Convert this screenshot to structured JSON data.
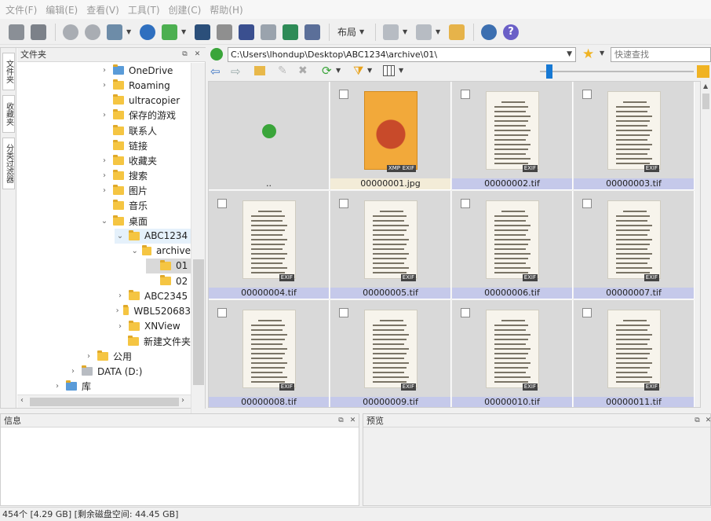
{
  "menu": [
    "文件(F)",
    "编辑(E)",
    "查看(V)",
    "工具(T)",
    "创建(C)",
    "帮助(H)"
  ],
  "toolbar": {
    "layout_label": "布局"
  },
  "side_tabs": [
    "文件夹",
    "收藏夹",
    "分类过滤器"
  ],
  "folder_panel_title": "文件夹",
  "tree": [
    {
      "label": "OneDrive",
      "indent": 1,
      "chevron": "›",
      "icon": "cloud-icon"
    },
    {
      "label": "Roaming",
      "indent": 1,
      "chevron": "›",
      "icon": "folder-icon"
    },
    {
      "label": "ultracopier",
      "indent": 1,
      "chevron": "",
      "icon": "folder-icon"
    },
    {
      "label": "保存的游戏",
      "indent": 1,
      "chevron": "›",
      "icon": "saved-games-icon"
    },
    {
      "label": "联系人",
      "indent": 1,
      "chevron": "",
      "icon": "contacts-icon"
    },
    {
      "label": "链接",
      "indent": 1,
      "chevron": "",
      "icon": "links-icon"
    },
    {
      "label": "收藏夹",
      "indent": 1,
      "chevron": "›",
      "icon": "favorites-icon"
    },
    {
      "label": "搜索",
      "indent": 1,
      "chevron": "›",
      "icon": "search-folder-icon"
    },
    {
      "label": "图片",
      "indent": 1,
      "chevron": "›",
      "icon": "pictures-icon"
    },
    {
      "label": "音乐",
      "indent": 1,
      "chevron": "",
      "icon": "music-icon"
    },
    {
      "label": "桌面",
      "indent": 1,
      "chevron": "⌄",
      "icon": "desktop-icon"
    },
    {
      "label": "ABC1234",
      "indent": 2,
      "chevron": "⌄",
      "icon": "folder-icon",
      "state": "selected"
    },
    {
      "label": "archive",
      "indent": 3,
      "chevron": "⌄",
      "icon": "folder-icon"
    },
    {
      "label": "01",
      "indent": 4,
      "chevron": "",
      "icon": "folder-open-icon",
      "state": "current"
    },
    {
      "label": "02",
      "indent": 4,
      "chevron": "",
      "icon": "folder-icon"
    },
    {
      "label": "ABC2345",
      "indent": 2,
      "chevron": "›",
      "icon": "folder-icon"
    },
    {
      "label": "WBL520683",
      "indent": 2,
      "chevron": "›",
      "icon": "folder-icon"
    },
    {
      "label": "XNView",
      "indent": 2,
      "chevron": "›",
      "icon": "folder-icon"
    },
    {
      "label": "新建文件夹",
      "indent": 2,
      "chevron": "",
      "icon": "folder-icon"
    },
    {
      "label": "公用",
      "indent": 0,
      "chevron": "›",
      "icon": "folder-icon"
    },
    {
      "label": "DATA (D:)",
      "indent": -1,
      "chevron": "›",
      "icon": "drive-icon"
    },
    {
      "label": "库",
      "indent": -2,
      "chevron": "›",
      "icon": "library-icon"
    }
  ],
  "address": "C:\\Users\\lhondup\\Desktop\\ABC1234\\archive\\01\\",
  "search_placeholder": "快速查找",
  "grid": [
    {
      "caption": "..",
      "kind": "up",
      "badges": []
    },
    {
      "caption": "00000001.jpg",
      "kind": "cover",
      "badges": [
        "XMP",
        "EXIF"
      ]
    },
    {
      "caption": "00000002.tif",
      "kind": "page",
      "badges": [
        "EXIF"
      ]
    },
    {
      "caption": "00000003.tif",
      "kind": "page",
      "badges": [
        "EXIF"
      ]
    },
    {
      "caption": "00000004.tif",
      "kind": "page",
      "badges": [
        "EXIF"
      ]
    },
    {
      "caption": "00000005.tif",
      "kind": "page",
      "badges": [
        "EXIF"
      ]
    },
    {
      "caption": "00000006.tif",
      "kind": "page",
      "badges": [
        "EXIF"
      ]
    },
    {
      "caption": "00000007.tif",
      "kind": "page",
      "badges": [
        "EXIF"
      ]
    },
    {
      "caption": "00000008.tif",
      "kind": "page",
      "badges": [
        "EXIF"
      ]
    },
    {
      "caption": "00000009.tif",
      "kind": "page",
      "badges": [
        "EXIF"
      ]
    },
    {
      "caption": "00000010.tif",
      "kind": "page",
      "badges": [
        "EXIF"
      ]
    },
    {
      "caption": "00000011.tif",
      "kind": "page",
      "badges": [
        "EXIF"
      ]
    }
  ],
  "info_panel_title": "信息",
  "preview_panel_title": "预览",
  "status": "454个 [4.29 GB] [剩余磁盘空间: 44.45 GB]",
  "colors": {
    "accent": "#1779d4",
    "caption_bg": "#c5c9ea",
    "cell_bg": "#d9d9d9",
    "folder": "#f5c542"
  }
}
